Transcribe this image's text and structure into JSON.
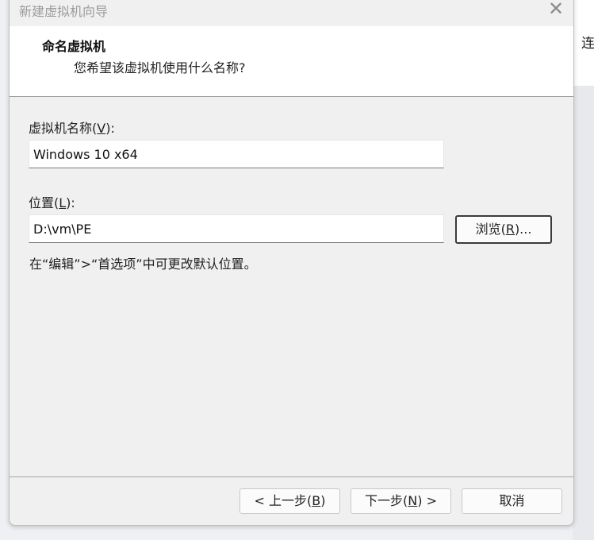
{
  "background_window": {
    "partial_text": "连"
  },
  "dialog": {
    "title": "新建虚拟机向导",
    "close_glyph": "✕",
    "header": {
      "title": "命名虚拟机",
      "subtitle": "您希望该虚拟机使用什么名称?"
    },
    "vm_name": {
      "label_prefix": "虚拟机名称(",
      "label_key": "V",
      "label_suffix": "):",
      "value": "Windows 10 x64"
    },
    "location": {
      "label_prefix": "位置(",
      "label_key": "L",
      "label_suffix": "):",
      "value": "D:\\vm\\PE",
      "browse_prefix": "浏览(",
      "browse_key": "R",
      "browse_suffix": ")..."
    },
    "hint": "在“编辑”>“首选项”中可更改默认位置。",
    "buttons": {
      "back_prefix": "< 上一步(",
      "back_key": "B",
      "back_suffix": ")",
      "next_prefix": "下一步(",
      "next_key": "N",
      "next_suffix": ") >",
      "cancel": "取消"
    }
  },
  "colors": {
    "dialog_bg": "#f0f0f0",
    "header_bg": "#ffffff",
    "title_text": "#9a9a9a"
  }
}
